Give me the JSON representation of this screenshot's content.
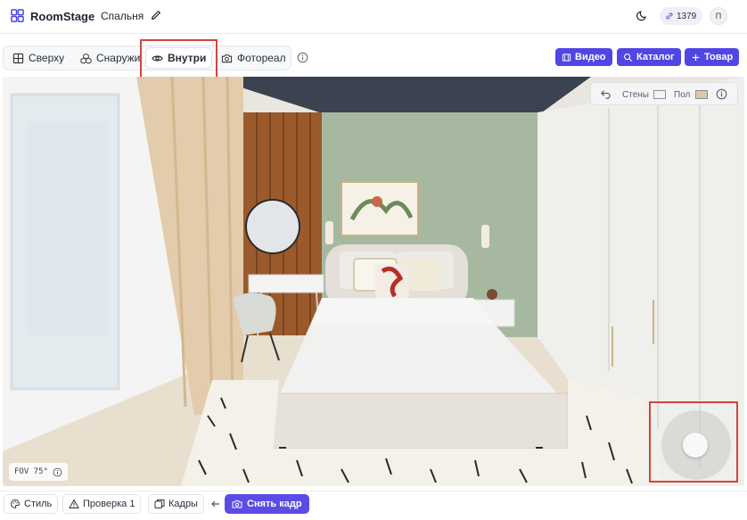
{
  "header": {
    "brand": "RoomStage",
    "project_name": "Спальня",
    "credits": "1379",
    "avatar_initial": "П"
  },
  "view_tabs": [
    {
      "label": "Сверху",
      "icon": "grid-icon",
      "active": false
    },
    {
      "label": "Снаружи",
      "icon": "cubes-icon",
      "active": false
    },
    {
      "label": "Внутри",
      "icon": "eye-icon",
      "active": true
    },
    {
      "label": "Фотореал",
      "icon": "camera-icon",
      "active": false
    }
  ],
  "actions": {
    "video": "Видео",
    "catalog": "Каталог",
    "product": "Товар"
  },
  "viewport": {
    "walls_label": "Стены",
    "floor_label": "Пол",
    "fov": "FOV 75°"
  },
  "bottom": {
    "style": "Стиль",
    "check": "Проверка 1",
    "frames": "Кадры",
    "capture": "Снять кадр"
  },
  "colors": {
    "accent": "#4f46e5",
    "highlight": "#d9423f",
    "wall_green": "#a6b9a0",
    "ceiling": "#3b4350"
  }
}
